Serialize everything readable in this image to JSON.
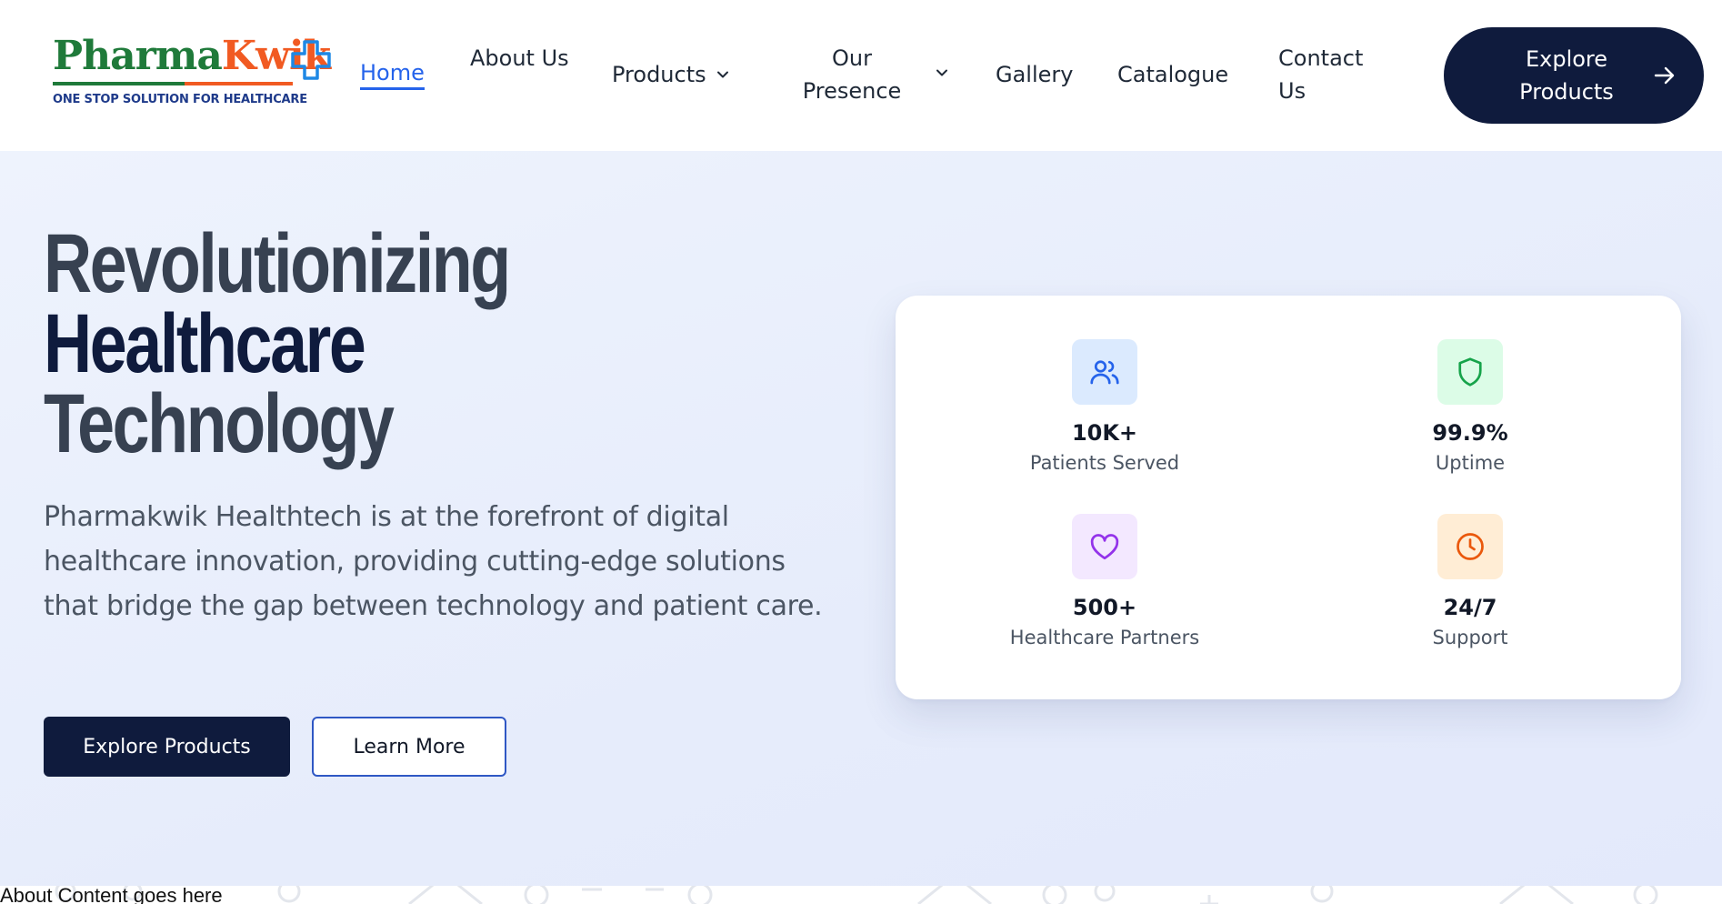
{
  "brand": {
    "name_part1": "Pharma",
    "name_part2": "Kwik",
    "tagline": "ONE STOP SOLUTION FOR HEALTHCARE",
    "green": "#1f7a3a",
    "orange": "#f15a22",
    "blue": "#1e3a8a"
  },
  "nav": {
    "home": "Home",
    "about": "About Us",
    "products": "Products",
    "presence": "Our Presence",
    "gallery": "Gallery",
    "catalogue": "Catalogue",
    "contact": "Contact Us",
    "cta": "Explore Products",
    "active_color": "#2563eb"
  },
  "hero": {
    "title_line1": "Revolutionizing",
    "title_line2": "Healthcare",
    "title_line3": "Technology",
    "description": "Pharmakwik Healthtech is at the forefront of digital healthcare innovation, providing cutting-edge solutions that bridge the gap between technology and patient care.",
    "primary_button": "Explore Products",
    "secondary_button": "Learn More",
    "navy": "#0f1b3d"
  },
  "stats": [
    {
      "value": "10K+",
      "label": "Patients Served",
      "icon": "users-icon",
      "bg": "#dbeafe",
      "color": "#2563eb"
    },
    {
      "value": "99.9%",
      "label": "Uptime",
      "icon": "shield-icon",
      "bg": "#dcfce7",
      "color": "#16a34a"
    },
    {
      "value": "500+",
      "label": "Healthcare Partners",
      "icon": "heart-icon",
      "bg": "#f3e8ff",
      "color": "#9333ea"
    },
    {
      "value": "24/7",
      "label": "Support",
      "icon": "clock-icon",
      "bg": "#ffedd5",
      "color": "#ea580c"
    }
  ],
  "about": {
    "text": "About Content goes here"
  }
}
